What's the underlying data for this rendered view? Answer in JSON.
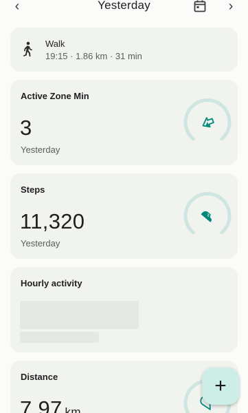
{
  "header": {
    "title": "Yesterday",
    "back_glyph": "‹",
    "forward_glyph": "›",
    "calendar_icon": "calendar-icon"
  },
  "walk": {
    "title": "Walk",
    "details": "19:15 · 1.86 km · 31 min",
    "icon": "walk-icon"
  },
  "active_zone": {
    "title": "Active Zone Min",
    "value": "3",
    "period": "Yesterday",
    "icon": "zone-arrows-icon",
    "goal_progress": 0.01
  },
  "steps": {
    "title": "Steps",
    "value": "11,320",
    "period": "Yesterday",
    "icon": "shoe-icon"
  },
  "hourly": {
    "title": "Hourly activity"
  },
  "distance": {
    "title": "Distance",
    "value": "7.97",
    "unit": "km",
    "icon": "location-icon"
  },
  "fab": {
    "label": "+"
  },
  "colors": {
    "accent": "#00897b",
    "ring_track": "#cfe5e1",
    "card_bg": "#f1f3ef",
    "fab_bg": "#cdeee6"
  }
}
